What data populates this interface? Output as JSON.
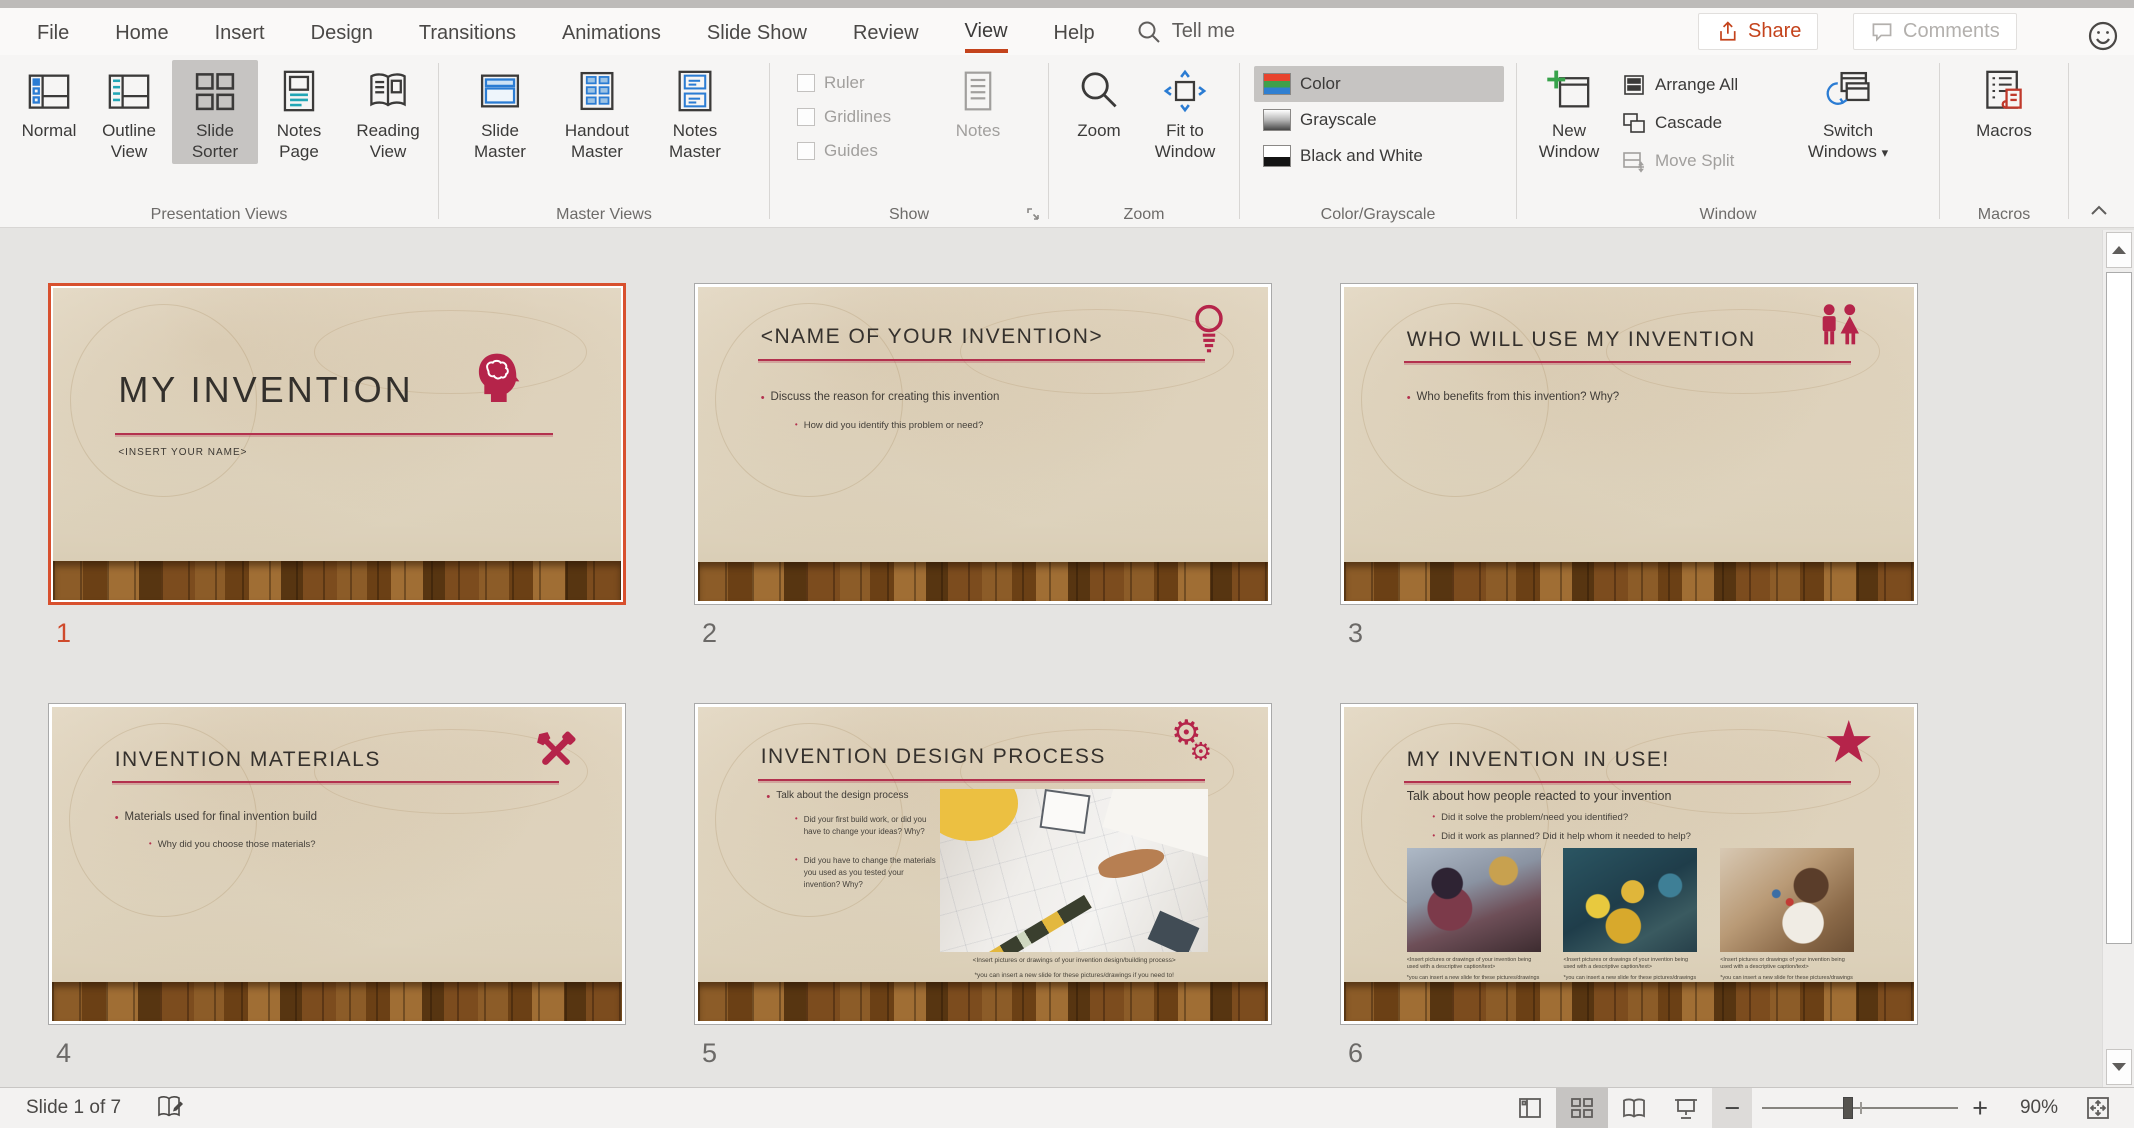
{
  "menu": {
    "tabs": [
      "File",
      "Home",
      "Insert",
      "Design",
      "Transitions",
      "Animations",
      "Slide Show",
      "Review",
      "View",
      "Help"
    ],
    "active_tab": "View",
    "tell_me": "Tell me",
    "share_label": "Share",
    "comments_label": "Comments"
  },
  "ribbon": {
    "presentation_views": {
      "group_label": "Presentation Views",
      "normal": "Normal",
      "outline_view": "Outline View",
      "slide_sorter": "Slide Sorter",
      "notes_page": "Notes Page",
      "reading_view": "Reading View",
      "selected": "Slide Sorter"
    },
    "master_views": {
      "group_label": "Master Views",
      "slide_master": "Slide Master",
      "handout_master": "Handout Master",
      "notes_master": "Notes Master"
    },
    "show": {
      "group_label": "Show",
      "ruler": "Ruler",
      "gridlines": "Gridlines",
      "guides": "Guides",
      "notes": "Notes"
    },
    "zoom": {
      "group_label": "Zoom",
      "zoom": "Zoom",
      "fit_to_window": "Fit to Window"
    },
    "color_grayscale": {
      "group_label": "Color/Grayscale",
      "color": "Color",
      "grayscale": "Grayscale",
      "black_and_white": "Black and White",
      "selected": "Color"
    },
    "window": {
      "group_label": "Window",
      "new_window": "New Window",
      "arrange_all": "Arrange All",
      "cascade": "Cascade",
      "move_split": "Move Split",
      "switch_windows": "Switch Windows",
      "switch_windows_arrow": "▾"
    },
    "macros": {
      "group_label": "Macros",
      "macros": "Macros"
    }
  },
  "slides": {
    "s1": {
      "number": "1",
      "selected": true,
      "title": "MY INVENTION",
      "subtitle": "<INSERT YOUR NAME>",
      "icon": "head-brain-icon"
    },
    "s2": {
      "number": "2",
      "title": "<NAME OF YOUR INVENTION>",
      "icon": "lightbulb-icon",
      "bullet1": "Discuss the reason for creating this invention",
      "sub1": "How did you identify this problem or need?"
    },
    "s3": {
      "number": "3",
      "title": "WHO WILL USE MY INVENTION",
      "icon": "people-icon",
      "bullet1": "Who benefits from this invention? Why?"
    },
    "s4": {
      "number": "4",
      "title": "INVENTION MATERIALS",
      "icon": "tools-icon",
      "bullet1": "Materials used for final invention build",
      "sub1": "Why did you choose those materials?"
    },
    "s5": {
      "number": "5",
      "title": "INVENTION DESIGN PROCESS",
      "icon": "gears-icon",
      "bullet1": "Talk about the design process",
      "sub1": "Did your first build work, or did you have to change your ideas? Why?",
      "sub2": "Did you have to change the materials you used as you tested your invention? Why?",
      "caption1": "<Insert pictures or drawings of your invention design/building process>",
      "caption2": "*you can insert a new slide for these pictures/drawings if you need to!"
    },
    "s6": {
      "number": "6",
      "title": "MY INVENTION IN USE!",
      "icon": "star-icon",
      "intro": "Talk about how people reacted to your invention",
      "bullet1": "Did it solve the problem/need you identified?",
      "bullet2": "Did it work as planned? Did it help whom it needed to help?",
      "caption1": "<Insert pictures or drawings of your invention being used with a descriptive caption/text>",
      "caption2": "*you can insert a new slide for these pictures/drawings if you need to!"
    }
  },
  "status_bar": {
    "slide_indicator": "Slide 1 of 7",
    "zoom_level": "90%"
  },
  "icons": {
    "gear_glyph": "⚙",
    "star_glyph": "★"
  },
  "colors": {
    "tab_accent": "#c4431c",
    "slide_accent": "#b3314e",
    "selection_border": "#d8502e",
    "ribbon_selected_bg": "#c6c4c2"
  }
}
